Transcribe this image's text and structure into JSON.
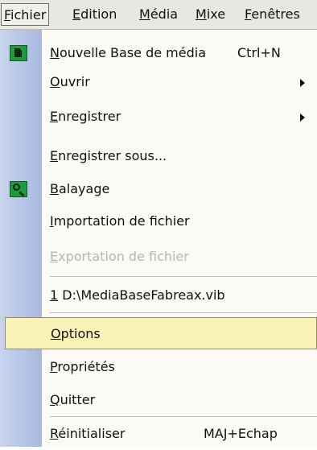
{
  "menubar": {
    "items": [
      {
        "access": "F",
        "rest": "ichier"
      },
      {
        "access": "E",
        "rest": "dition"
      },
      {
        "access": "M",
        "rest": "édia"
      },
      {
        "access": "M",
        "rest": "ixe"
      },
      {
        "access": "F",
        "rest": "enêtres"
      }
    ]
  },
  "menu": {
    "items": [
      {
        "access": "N",
        "rest": "ouvelle Base de média",
        "shortcut": "Ctrl+N",
        "icon": "new-media-base-icon"
      },
      {
        "access": "O",
        "rest": "uvrir",
        "submenu": true
      },
      {
        "access": "E",
        "rest": "nregistrer",
        "submenu": true
      },
      {
        "access": "E",
        "rest": "nregistrer sous..."
      },
      {
        "access": "B",
        "rest": "alayage",
        "icon": "scan-magnifier-icon"
      },
      {
        "access": "I",
        "rest": "mportation de fichier"
      },
      {
        "access": "E",
        "rest": "xportation de fichier",
        "disabled": true
      },
      {
        "access": "1",
        "rest": " D:\\MediaBaseFabreax.vib"
      },
      {
        "access": "O",
        "rest": "ptions",
        "highlighted": true
      },
      {
        "access": "P",
        "rest": "ropriétés"
      },
      {
        "access": "Q",
        "rest": "uitter"
      },
      {
        "access": "R",
        "rest": "éinitialiser",
        "shortcut": "MAJ+Echap"
      }
    ]
  },
  "colors": {
    "menubar_bg": "#e9e7e1",
    "menu_bg": "#fbfaf7",
    "gutter": "#b5c3e6",
    "highlight_bg": "#fbf2b8",
    "highlight_border": "#8f8a72",
    "disabled_text": "#b8b6b0",
    "icon_green": "#1f9a3c"
  }
}
